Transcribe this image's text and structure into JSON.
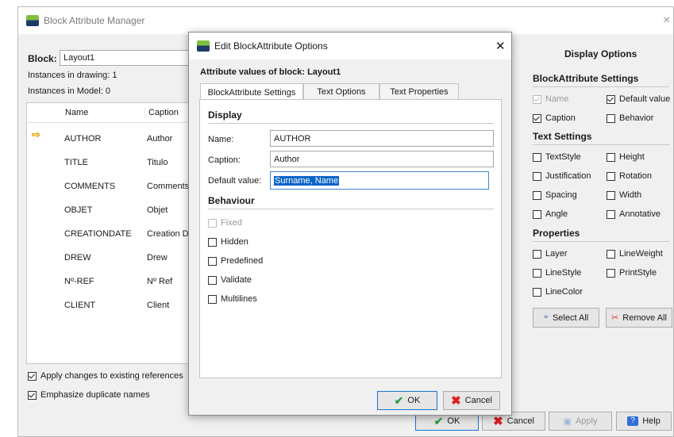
{
  "main_window": {
    "title": "Block Attribute Manager",
    "close_glyph": "×",
    "block_label": "Block:",
    "block_value": "Layout1",
    "instances_drawing": "Instances in drawing: 1",
    "instances_model": "Instances in Model: 0",
    "columns": [
      "Name",
      "Caption"
    ],
    "rows": [
      {
        "name": "AUTHOR",
        "caption": "Author"
      },
      {
        "name": "TITLE",
        "caption": "Titulo"
      },
      {
        "name": "COMMENTS",
        "caption": "Comments"
      },
      {
        "name": "OBJET",
        "caption": "Objet"
      },
      {
        "name": "CREATIONDATE",
        "caption": "Creation D"
      },
      {
        "name": "DREW",
        "caption": "Drew"
      },
      {
        "name": "Nº-REF",
        "caption": "Nº Ref"
      },
      {
        "name": "CLIENT",
        "caption": "Client"
      }
    ],
    "apply_changes_label": "Apply changes to existing references",
    "emphasize_label": "Emphasize duplicate names",
    "buttons": {
      "ok": "OK",
      "cancel": "Cancel",
      "apply": "Apply",
      "help": "Help"
    }
  },
  "display_options": {
    "title": "Display Options",
    "blockattribute_settings": "BlockAttribute Settings",
    "ba_items": [
      {
        "label": "Name",
        "checked": true,
        "disabled": true
      },
      {
        "label": "Default value",
        "checked": true,
        "disabled": false
      },
      {
        "label": "Caption",
        "checked": true,
        "disabled": false
      },
      {
        "label": "Behavior",
        "checked": false,
        "disabled": false
      }
    ],
    "text_settings": "Text Settings",
    "text_items": [
      "TextStyle",
      "Height",
      "Justification",
      "Rotation",
      "Spacing",
      "Width",
      "Angle",
      "Annotative"
    ],
    "properties": "Properties",
    "prop_items": [
      "Layer",
      "LineWeight",
      "LineStyle",
      "PrintStyle",
      "LineColor"
    ],
    "select_all": "Select All",
    "remove_all": "Remove All"
  },
  "dialog": {
    "title": "Edit BlockAttribute Options",
    "close_glyph": "✕",
    "heading": "Attribute values of block: Layout1",
    "tabs": [
      "BlockAttribute Settings",
      "Text Options",
      "Text Properties"
    ],
    "display_section": "Display",
    "name_label": "Name:",
    "name_value": "AUTHOR",
    "caption_label": "Caption:",
    "caption_value": "Author",
    "default_label": "Default value:",
    "default_value": "Surname, Name",
    "behaviour_section": "Behaviour",
    "behaviour_items": [
      {
        "label": "Fixed",
        "checked": false,
        "disabled": true
      },
      {
        "label": "Hidden",
        "checked": false,
        "disabled": false
      },
      {
        "label": "Predefined",
        "checked": false,
        "disabled": false
      },
      {
        "label": "Validate",
        "checked": false,
        "disabled": false
      },
      {
        "label": "Multilines",
        "checked": false,
        "disabled": false
      }
    ],
    "ok": "OK",
    "cancel": "Cancel"
  }
}
